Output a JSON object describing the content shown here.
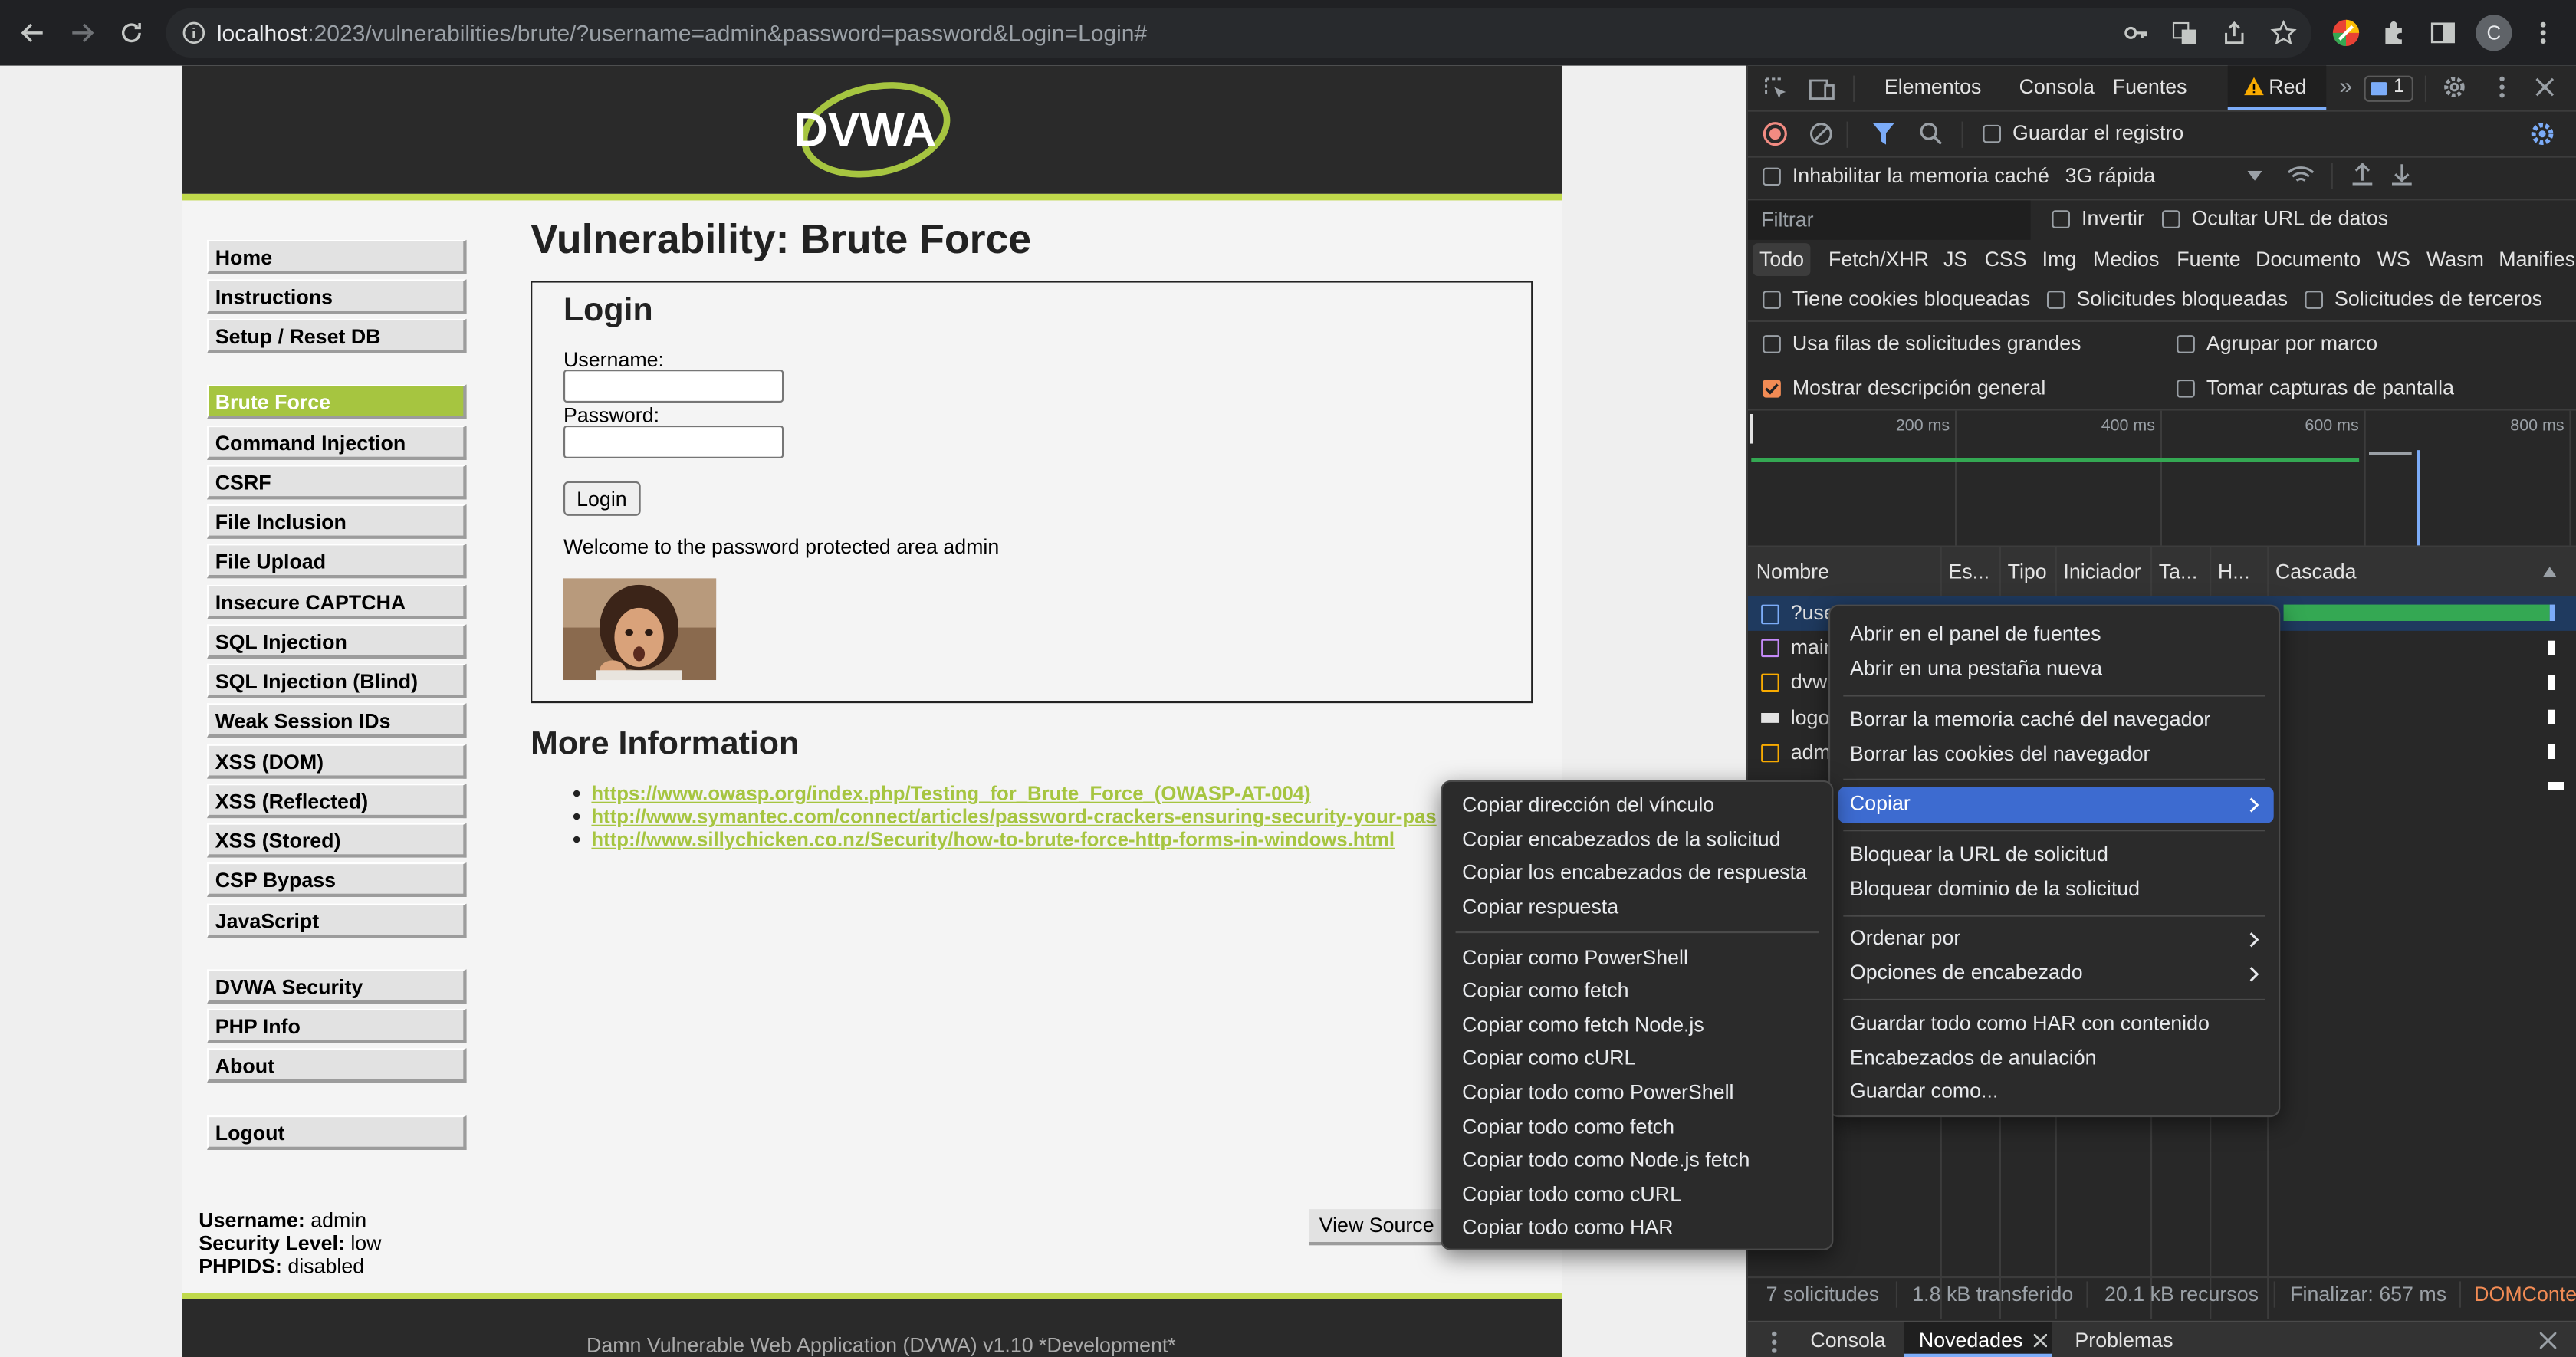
{
  "browser": {
    "url_host": "localhost",
    "url_rest": ":2023/vulnerabilities/brute/?username=admin&password=password&Login=Login#",
    "profile_initial": "C"
  },
  "page": {
    "title": "Vulnerability: Brute Force",
    "menu": [
      "Home",
      "Instructions",
      "Setup / Reset DB",
      "Brute Force",
      "Command Injection",
      "CSRF",
      "File Inclusion",
      "File Upload",
      "Insecure CAPTCHA",
      "SQL Injection",
      "SQL Injection (Blind)",
      "Weak Session IDs",
      "XSS (DOM)",
      "XSS (Reflected)",
      "XSS (Stored)",
      "CSP Bypass",
      "JavaScript",
      "DVWA Security",
      "PHP Info",
      "About",
      "Logout"
    ],
    "login": {
      "heading": "Login",
      "username_label": "Username:",
      "password_label": "Password:",
      "button": "Login",
      "welcome": "Welcome to the password protected area admin"
    },
    "more_info": "More Information",
    "links": [
      "https://www.owasp.org/index.php/Testing_for_Brute_Force_(OWASP-AT-004)",
      "http://www.symantec.com/connect/articles/password-crackers-ensuring-security-your-pas",
      "http://www.sillychicken.co.nz/Security/how-to-brute-force-http-forms-in-windows.html"
    ],
    "status": {
      "username_label": "Username:",
      "username": "admin",
      "security_label": "Security Level:",
      "security": "low",
      "phpids_label": "PHPIDS:",
      "phpids": "disabled"
    },
    "view_source": "View Source",
    "footer": "Damn Vulnerable Web Application (DVWA) v1.10 *Development*",
    "logo_text": "DVWA"
  },
  "devtools": {
    "tabs": [
      "Elementos",
      "Consola",
      "Fuentes",
      "Red"
    ],
    "issues_count": "1",
    "preserve_log": "Guardar el registro",
    "disable_cache": "Inhabilitar la memoria caché",
    "throttle": "3G rápida",
    "filter_placeholder": "Filtrar",
    "invert": "Invertir",
    "hide_data_urls": "Ocultar URL de datos",
    "types": [
      "Todo",
      "Fetch/XHR",
      "JS",
      "CSS",
      "Img",
      "Medios",
      "Fuente",
      "Documento",
      "WS",
      "Wasm",
      "Manifies"
    ],
    "blocked_cookies": "Tiene cookies bloqueadas",
    "blocked_requests": "Solicitudes bloqueadas",
    "third_party": "Solicitudes de terceros",
    "large_rows": "Usa filas de solicitudes grandes",
    "group_frame": "Agrupar por marco",
    "overview": "Mostrar descripción general",
    "screenshots": "Tomar capturas de pantalla",
    "timeline_ticks": [
      "200 ms",
      "400 ms",
      "600 ms",
      "800 ms"
    ],
    "columns": [
      "Nombre",
      "Es...",
      "Tipo",
      "Iniciador",
      "Ta...",
      "H...",
      "Cascada"
    ],
    "rows": [
      "?username=a",
      "main",
      "dvwa",
      "logo",
      "adm"
    ],
    "summary": {
      "requests": "7 solicitudes",
      "transferred": "1.8 kB transferido",
      "resources": "20.1 kB recursos",
      "finish": "Finalizar: 657 ms",
      "domcontent": "DOMConte"
    },
    "drawer_tabs": [
      "Consola",
      "Novedades",
      "Problemas"
    ]
  },
  "context_menu": [
    "Abrir en el panel de fuentes",
    "Abrir en una pestaña nueva",
    "Borrar la memoria caché del navegador",
    "Borrar las cookies del navegador",
    "Copiar",
    "Bloquear la URL de solicitud",
    "Bloquear dominio de la solicitud",
    "Ordenar por",
    "Opciones de encabezado",
    "Guardar todo como HAR con contenido",
    "Encabezados de anulación",
    "Guardar como..."
  ],
  "copy_submenu": [
    "Copiar dirección del vínculo",
    "Copiar encabezados de la solicitud",
    "Copiar los encabezados de respuesta",
    "Copiar respuesta",
    "Copiar como PowerShell",
    "Copiar como fetch",
    "Copiar como fetch Node.js",
    "Copiar como cURL",
    "Copiar todo como PowerShell",
    "Copiar todo como fetch",
    "Copiar todo como Node.js fetch",
    "Copiar todo como cURL",
    "Copiar todo como HAR"
  ]
}
